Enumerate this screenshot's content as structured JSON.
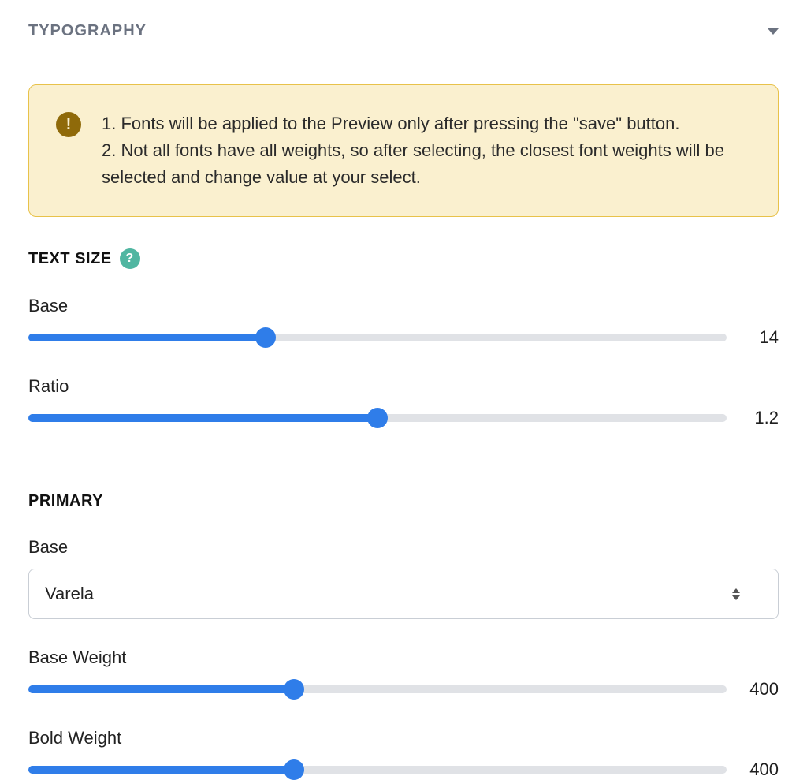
{
  "panel": {
    "title": "TYPOGRAPHY"
  },
  "notice": {
    "line1": "1. Fonts will be applied to the Preview only after pressing the \"save\" button.",
    "line2": "2. Not all fonts have all weights, so after selecting, the closest font weights will be selected and change value at your select."
  },
  "text_size": {
    "heading": "TEXT SIZE",
    "base_label": "Base",
    "base_value": "14",
    "base_fill_pct": 34,
    "ratio_label": "Ratio",
    "ratio_value": "1.2",
    "ratio_fill_pct": 50
  },
  "primary": {
    "heading": "PRIMARY",
    "base_label": "Base",
    "base_font": "Varela",
    "base_weight_label": "Base Weight",
    "base_weight_value": "400",
    "base_weight_fill_pct": 38,
    "bold_weight_label": "Bold Weight",
    "bold_weight_value": "400",
    "bold_weight_fill_pct": 38
  }
}
